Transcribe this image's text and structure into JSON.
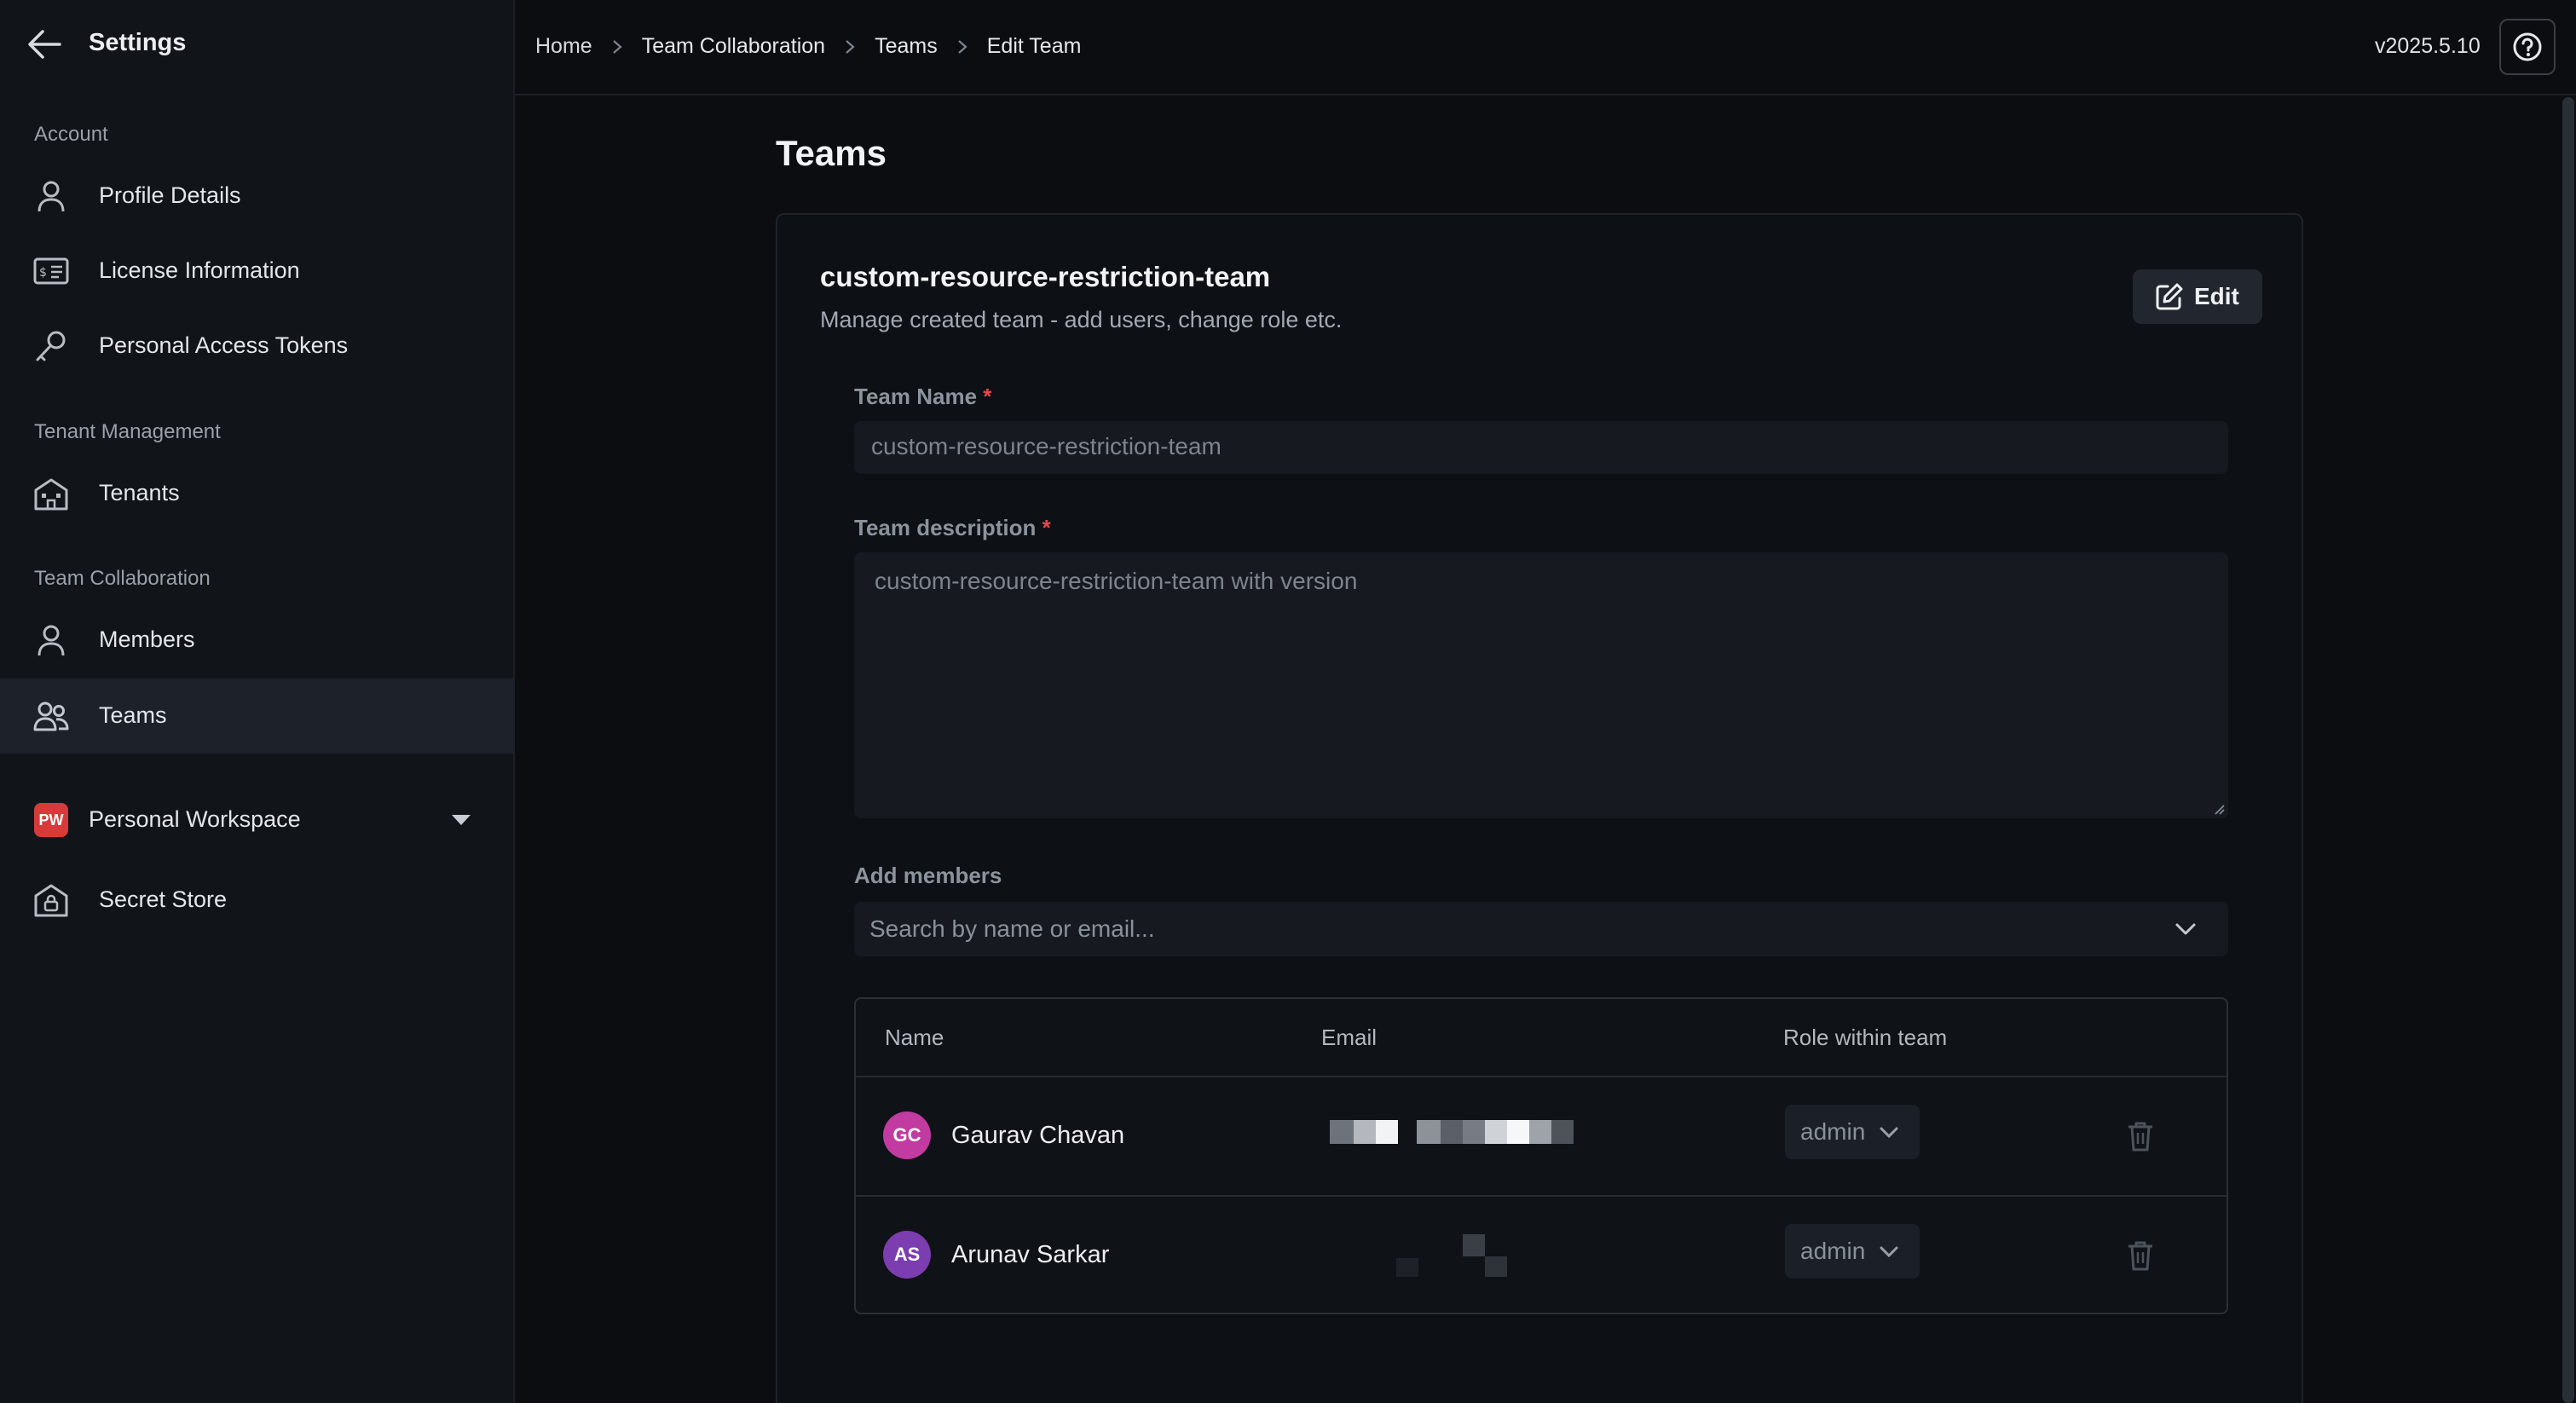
{
  "sidebar": {
    "title": "Settings",
    "sections": {
      "account": "Account",
      "tenant": "Tenant Management",
      "team": "Team Collaboration"
    },
    "items": {
      "profile": "Profile Details",
      "license": "License Information",
      "tokens": "Personal Access Tokens",
      "tenants": "Tenants",
      "members": "Members",
      "teams": "Teams",
      "workspace_badge": "PW",
      "workspace": "Personal Workspace",
      "secret_store": "Secret Store"
    },
    "active_item": "Teams"
  },
  "topbar": {
    "breadcrumbs": [
      "Home",
      "Team Collaboration",
      "Teams",
      "Edit Team"
    ],
    "version": "v2025.5.10"
  },
  "main": {
    "page_title": "Teams",
    "card": {
      "title": "custom-resource-restriction-team",
      "subtitle": "Manage created team - add users, change role etc.",
      "edit_label": "Edit"
    },
    "form": {
      "team_name_label": "Team Name",
      "team_name_value": "custom-resource-restriction-team",
      "description_label": "Team description",
      "description_value": "custom-resource-restriction-team with version",
      "required_mark": "*",
      "add_members_label": "Add members",
      "add_members_placeholder": "Search by name or email..."
    },
    "table": {
      "headers": {
        "name": "Name",
        "email": "Email",
        "role": "Role within team"
      },
      "rows": [
        {
          "initials": "GC",
          "name": "Gaurav Chavan",
          "role": "admin",
          "avatar_color": "#c13ba0"
        },
        {
          "initials": "AS",
          "name": "Arunav Sarkar",
          "role": "admin",
          "avatar_color": "#7b3db0"
        }
      ]
    }
  },
  "colors": {
    "background": "#0b0d11",
    "sidebar": "#111418",
    "active_item": "#1c212a",
    "required": "#e5484d",
    "workspace_badge": "#d83a3a"
  }
}
